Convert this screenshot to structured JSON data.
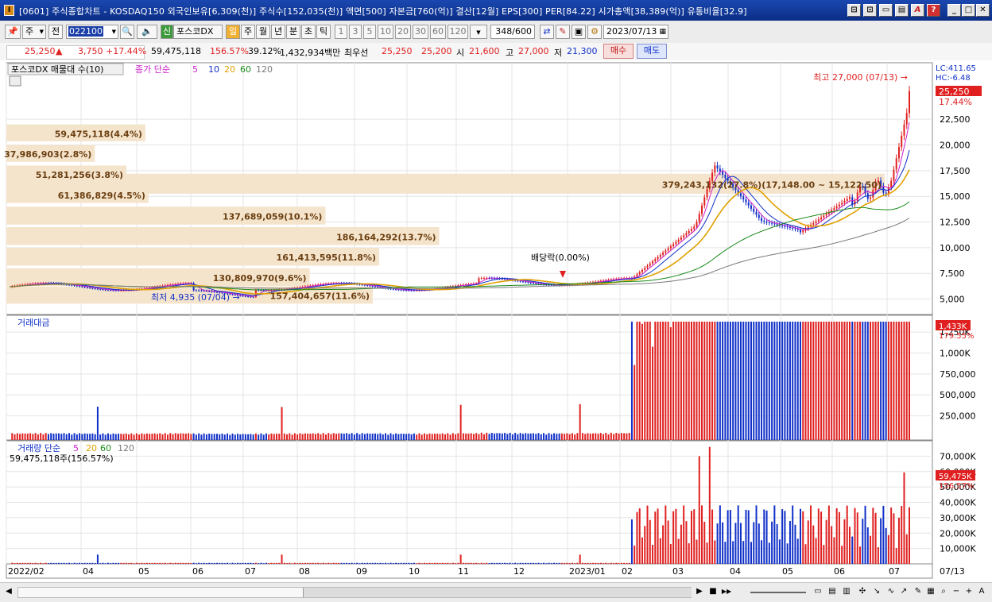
{
  "window": {
    "title": "[0601] 주식종합차트 - KOSDAQ150 외국인보유[6,309(천)] 주식수[152,035(천)] 액면[500] 자본금[760(억)] 결산[12월] EPS[300] PER[84.22] 시가총액[38,389(억)] 유통비율[32.9]",
    "icon_label": "I",
    "buttons": [
      "⊟",
      "⊡",
      "▭",
      "▤",
      "A",
      "?",
      "_",
      "□",
      "✕"
    ]
  },
  "toolbar": {
    "market": "주",
    "prev_label": "전",
    "code": "022100",
    "badge": "신",
    "stock_name": "포스코DX",
    "periods": [
      "일",
      "주",
      "월",
      "년",
      "분",
      "초",
      "틱"
    ],
    "intervals": [
      "1",
      "3",
      "5",
      "10",
      "20",
      "30",
      "60",
      "120"
    ],
    "count": "348",
    "count_total": "/600",
    "date": "2023/07/13"
  },
  "quote": {
    "price": "25,250",
    "arrow": "▲",
    "change": "3,750",
    "change_pct": "+17.44%",
    "volume": "59,475,118",
    "volume_ratio": "156.57%",
    "turnover": "39.12%",
    "amount": "1,432,934백만",
    "bid_label": "최우선",
    "bid": "25,250",
    "ask": "25,200",
    "open_label": "시",
    "open": "21,600",
    "high_label": "고",
    "high": "27,000",
    "low_label": "저",
    "low": "21,300",
    "buy": "매수",
    "sell": "매도"
  },
  "colors": {
    "up": "#e02020",
    "down": "#1030c8",
    "ma5": "#cc20cc",
    "ma10": "#1030c8",
    "ma20": "#e0a000",
    "ma60": "#1a8a1a",
    "ma120": "#7a7a7a",
    "profile": "#f5e4cc"
  },
  "price_panel": {
    "title": "포스코DX 매물대 수(10)",
    "ma_label": "종가 단순",
    "ma_periods": [
      "5",
      "10",
      "20",
      "60",
      "120"
    ],
    "lc": "LC:411.65",
    "hc": "HC:-6.48",
    "current_price": "25,250",
    "current_pct": "17.44%",
    "high_note": "최고 27,000 (07/13) →",
    "low_note": "최저 4,935 (07/04) →",
    "dividend_note": "배당락(0.00%)",
    "y_ticks": [
      "22,500",
      "20,000",
      "17,500",
      "15,000",
      "12,500",
      "10,000",
      "7,500",
      "5,000"
    ],
    "profile": [
      {
        "label": "59,475,118(4.4%)",
        "lo": 20200,
        "hi": 22000,
        "pct": 4.4
      },
      {
        "label": "37,986,903(2.8%)",
        "lo": 18200,
        "hi": 20000,
        "pct": 2.8
      },
      {
        "label": "51,281,256(3.8%)",
        "lo": 16200,
        "hi": 18000,
        "pct": 3.8
      },
      {
        "label": "61,386,829(4.5%)",
        "lo": 14200,
        "hi": 16000,
        "pct": 4.5
      },
      {
        "label": "379,243,132(27.8%)(17,148.00 ~ 15,122.50)",
        "lo": 15100,
        "hi": 17200,
        "pct": 27.8
      },
      {
        "label": "137,689,059(10.1%)",
        "lo": 12100,
        "hi": 14000,
        "pct": 10.1
      },
      {
        "label": "186,164,292(13.7%)",
        "lo": 10100,
        "hi": 12000,
        "pct": 13.7
      },
      {
        "label": "161,413,595(11.8%)",
        "lo": 8100,
        "hi": 10000,
        "pct": 11.8
      },
      {
        "label": "130,809,970(9.6%)",
        "lo": 6100,
        "hi": 8000,
        "pct": 9.6
      },
      {
        "label": "157,404,657(11.6%)",
        "lo": 4400,
        "hi": 6200,
        "pct": 11.6
      }
    ]
  },
  "amount_panel": {
    "title": "거래대금",
    "current": "1,433K",
    "current_pct": "179.55%",
    "y_ticks": [
      "1,250K",
      "1,000K",
      "750,000",
      "500,000",
      "250,000"
    ]
  },
  "volume_panel": {
    "title": "거래량 단순",
    "ma_periods": [
      "5",
      "20",
      "60",
      "120"
    ],
    "value_label": "59,475,118주(156.57%)",
    "current": "59,475K",
    "current_pct": "156.57%",
    "y_ticks": [
      "70,000K",
      "60,000K",
      "50,000K",
      "40,000K",
      "30,000K",
      "20,000K",
      "10,000K"
    ]
  },
  "x_axis": {
    "labels": [
      "2022/02",
      "04",
      "05",
      "06",
      "07",
      "08",
      "09",
      "10",
      "11",
      "12",
      "2023/01",
      "02",
      "03",
      "04",
      "05",
      "06",
      "07"
    ],
    "end_label": "07/13"
  },
  "scrollbar": {
    "buttons": [
      "▶",
      "■",
      "▶▶"
    ],
    "zoom": [
      "−",
      "+",
      "A"
    ]
  }
}
